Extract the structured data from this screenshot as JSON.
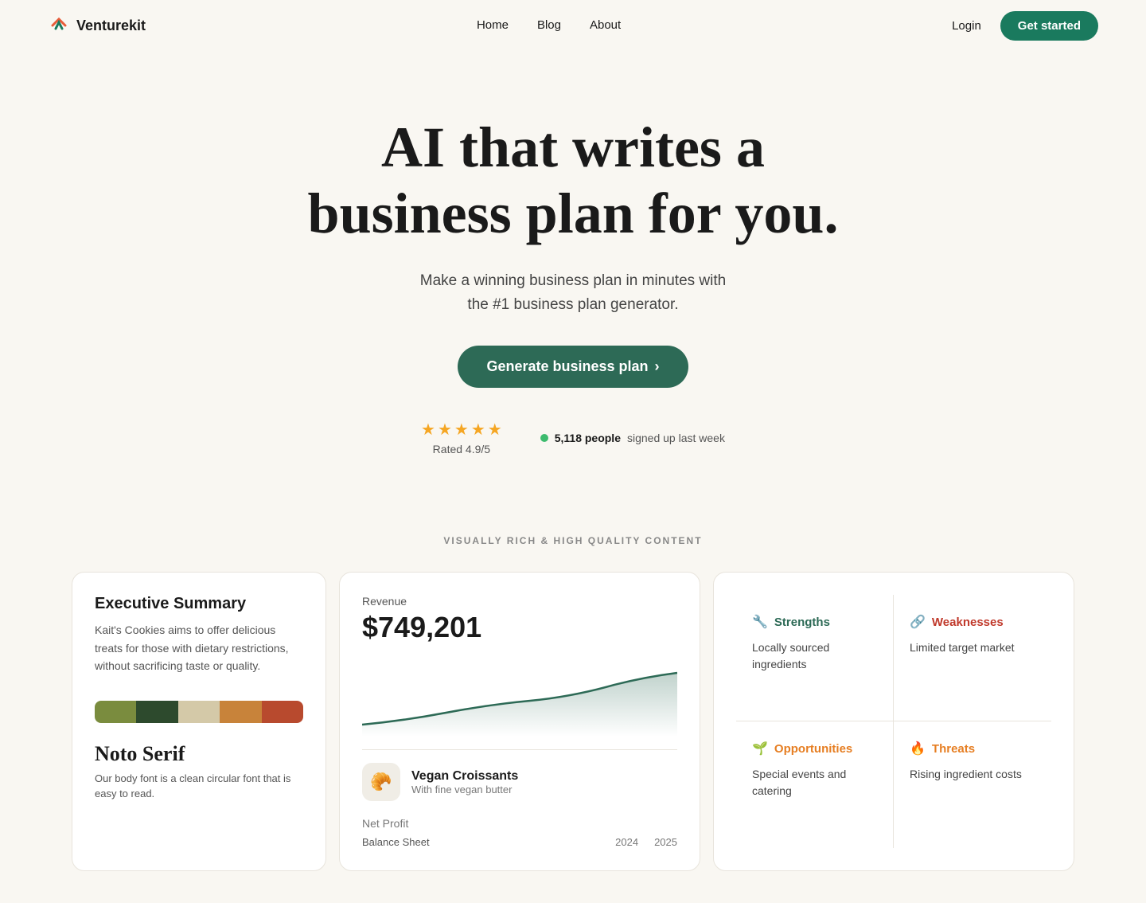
{
  "nav": {
    "logo_text": "Venturekit",
    "links": [
      {
        "label": "Home",
        "id": "home"
      },
      {
        "label": "Blog",
        "id": "blog"
      },
      {
        "label": "About",
        "id": "about"
      }
    ],
    "login_label": "Login",
    "cta_label": "Get started"
  },
  "hero": {
    "headline_line1": "AI that writes a",
    "headline_line2": "business plan for you.",
    "subtext_line1": "Make a winning business plan in minutes with",
    "subtext_line2": "the #1 business plan generator.",
    "cta_label": "Generate business plan",
    "rating_label": "Rated 4.9/5",
    "signup_count": "5,118 people",
    "signup_label": "signed up last week"
  },
  "section_label": "VISUALLY RICH & HIGH QUALITY CONTENT",
  "left_card": {
    "executive_title": "Executive Summary",
    "executive_desc": "Kait's Cookies aims to offer delicious treats for those with dietary restrictions, without sacrificing taste or quality.",
    "swatches": [
      {
        "color": "#7a8c3e"
      },
      {
        "color": "#2d4a2d"
      },
      {
        "color": "#d4c9a8"
      },
      {
        "color": "#c8833a"
      },
      {
        "color": "#b84a2e"
      }
    ],
    "font_name": "Noto Serif",
    "font_desc": "Our body font is a clean circular font that is easy to read."
  },
  "middle_card": {
    "revenue_label": "Revenue",
    "revenue_amount": "$749,201",
    "product_name": "Vegan Croissants",
    "product_sub": "With fine vegan butter",
    "net_profit_label": "Net Profit"
  },
  "right_card": {
    "strengths_label": "Strengths",
    "strengths_text": "Locally sourced ingredients",
    "weaknesses_label": "Weaknesses",
    "weaknesses_text": "Limited target market",
    "opportunities_label": "Opportunities",
    "opportunities_text": "Special events and catering",
    "threats_label": "Threats",
    "threats_text": "Rising ingredient costs"
  },
  "balance_sheet": {
    "label": "Balance Sheet",
    "year1": "2024",
    "year2": "2025"
  }
}
